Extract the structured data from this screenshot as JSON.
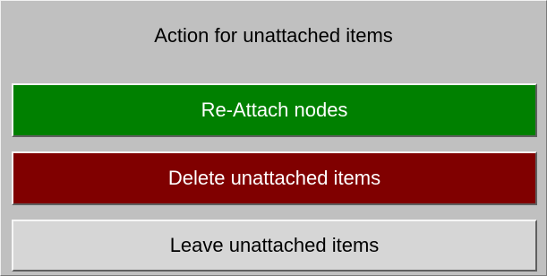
{
  "dialog": {
    "title": "Action for unattached items",
    "buttons": [
      {
        "label": "Re-Attach nodes",
        "color": "#008000"
      },
      {
        "label": "Delete unattached items",
        "color": "#800000"
      },
      {
        "label": "Leave unattached items",
        "color": "#d6d6d6"
      }
    ]
  }
}
